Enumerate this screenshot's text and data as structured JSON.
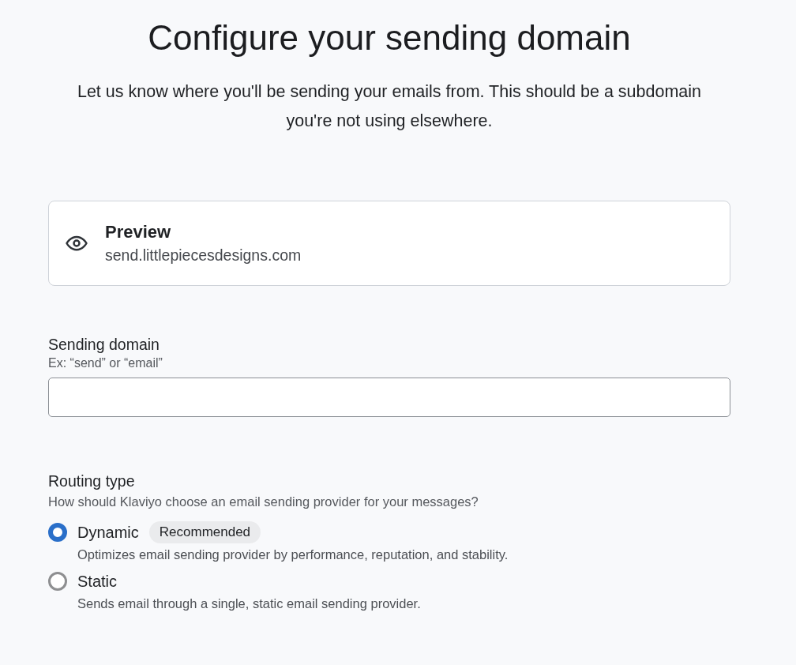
{
  "title": "Configure your sending domain",
  "subtitle": "Let us know where you'll be sending your emails from. This should be a subdomain you're not using elsewhere.",
  "preview": {
    "heading": "Preview",
    "value": "send.littlepiecesdesigns.com"
  },
  "sending_domain": {
    "label": "Sending domain",
    "hint": "Ex: “send” or “email”"
  },
  "routing": {
    "label": "Routing type",
    "hint": "How should Klaviyo choose an email sending provider for your messages?",
    "options": [
      {
        "label": "Dynamic",
        "badge": "Recommended",
        "description": "Optimizes email sending provider by performance, reputation, and stability.",
        "selected": true
      },
      {
        "label": "Static",
        "description": "Sends email through a single, static email sending provider.",
        "selected": false
      }
    ]
  }
}
